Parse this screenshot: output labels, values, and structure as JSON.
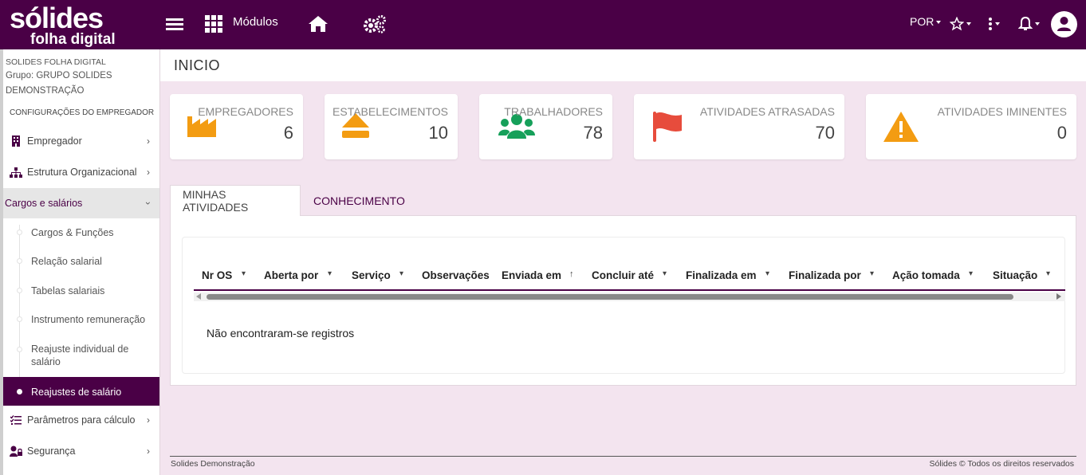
{
  "topbar": {
    "logo_line1": "sólides",
    "logo_line2": "folha digital",
    "modules_label": "Módulos",
    "language": "POR"
  },
  "sidebar": {
    "company": "SOLIDES FOLHA DIGITAL",
    "group": "Grupo: GRUPO SOLIDES",
    "group_name": "DEMONSTRAÇÃO",
    "section": "CONFIGURAÇÕES DO EMPREGADOR",
    "items": [
      {
        "label": "Empregador",
        "icon": "building-icon"
      },
      {
        "label": "Estrutura Organizacional",
        "icon": "sitemap-icon"
      },
      {
        "label": "Cargos e salários",
        "icon": "none"
      },
      {
        "label": "Parâmetros para cálculo",
        "icon": "list-check-icon"
      },
      {
        "label": "Segurança",
        "icon": "user-lock-icon"
      }
    ],
    "sub_items": [
      {
        "label": "Cargos & Funções"
      },
      {
        "label": "Relação salarial"
      },
      {
        "label": "Tabelas salariais"
      },
      {
        "label": "Instrumento remuneração"
      },
      {
        "label": "Reajuste individual de salário",
        "line1": "Reajuste individual de",
        "line2": "salário"
      },
      {
        "label": "Reajustes de salário"
      }
    ]
  },
  "page": {
    "title": "INICIO"
  },
  "cards": [
    {
      "label": "EMPREGADORES",
      "value": "6",
      "icon": "industry-icon",
      "color": "#f39c12"
    },
    {
      "label": "ESTABELECIMENTOS",
      "value": "10",
      "icon": "eject-icon",
      "color": "#f39c12"
    },
    {
      "label": "TRABALHADORES",
      "value": "78",
      "icon": "users-icon",
      "color": "#16a05a"
    },
    {
      "label": "ATIVIDADES ATRASADAS",
      "value": "70",
      "icon": "flag-icon",
      "color": "#e74c3c"
    },
    {
      "label": "ATIVIDADES IMINENTES",
      "value": "0",
      "icon": "warning-icon",
      "color": "#f39c12"
    }
  ],
  "tabs": [
    {
      "label": "MINHAS ATIVIDADES",
      "active": true
    },
    {
      "label": "CONHECIMENTO",
      "active": false
    }
  ],
  "grid": {
    "columns": [
      "Nr OS",
      "Aberta por",
      "Serviço",
      "Observações",
      "Enviada em",
      "Concluir até",
      "Finalizada em",
      "Finalizada por",
      "Ação tomada",
      "Situação"
    ],
    "empty_message": "Não encontraram-se registros"
  },
  "footer": {
    "left": "Solides Demonstração",
    "right": "Sólides © Todos os direitos reservados"
  },
  "colors": {
    "brand": "#4a0046",
    "background": "#f3e4ef"
  }
}
